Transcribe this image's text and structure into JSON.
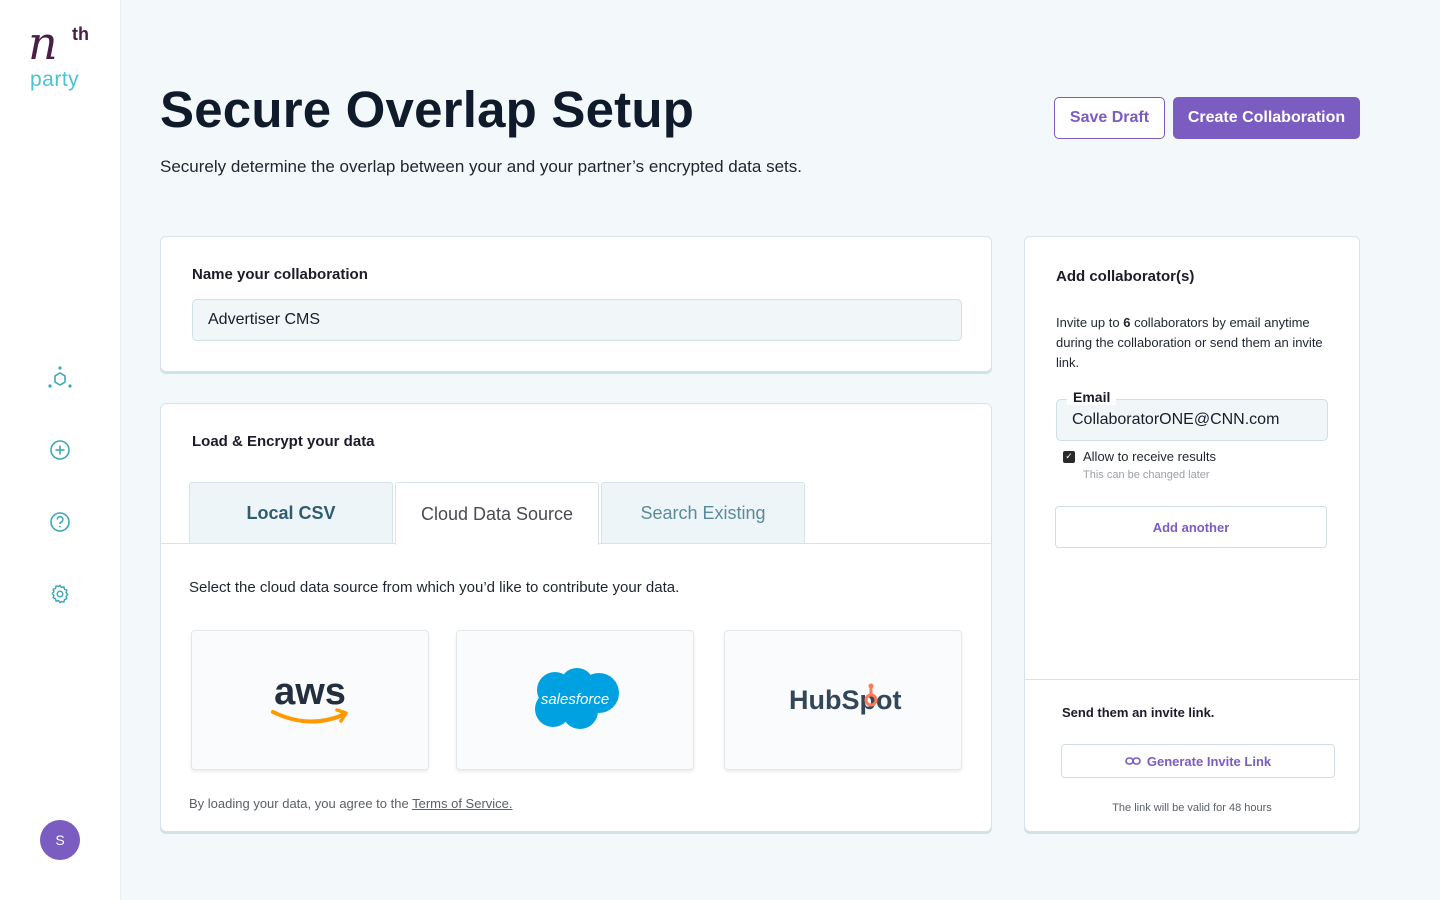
{
  "brand": {
    "logo_main": "n",
    "logo_sup": "th",
    "logo_sub": "party"
  },
  "sidebar": {
    "nav": [
      {
        "icon": "network-icon"
      },
      {
        "icon": "plus-circle-icon"
      },
      {
        "icon": "help-circle-icon"
      },
      {
        "icon": "gear-icon"
      }
    ],
    "avatar_initial": "S"
  },
  "header": {
    "title": "Secure Overlap Setup",
    "subtitle": "Securely determine the overlap between your and your partner’s encrypted data sets.",
    "save_draft_label": "Save Draft",
    "create_label": "Create Collaboration"
  },
  "name_card": {
    "label": "Name your collaboration",
    "value": "Advertiser CMS"
  },
  "load_card": {
    "label": "Load & Encrypt your data",
    "tabs": [
      {
        "label": "Local CSV"
      },
      {
        "label": "Cloud Data Source"
      },
      {
        "label": "Search Existing"
      }
    ],
    "description": "Select the cloud data source from which you’d like to contribute your data.",
    "sources": [
      {
        "label": "aws"
      },
      {
        "label": "salesforce"
      },
      {
        "label": "HubSpot"
      }
    ],
    "terms_prefix": "By loading your data, you agree to the ",
    "terms_link": "Terms of Service."
  },
  "collab_card": {
    "title": "Add collaborator(s)",
    "desc_prefix": "Invite up to ",
    "desc_count": "6",
    "desc_suffix": " collaborators by email anytime during the collaboration or send them an invite link.",
    "email_label": "Email",
    "email_value": "CollaboratorONE@CNN.com",
    "checkbox_label": "Allow to receive results",
    "checkbox_note": "This can be changed later",
    "add_another_label": "Add another",
    "invite_title": "Send them an invite link.",
    "generate_label": "Generate Invite Link",
    "link_note": "The link will be valid for 48 hours"
  },
  "colors": {
    "accent": "#7b5cc0",
    "teal": "#4cc3d2",
    "brand_dark": "#4a1f45"
  }
}
